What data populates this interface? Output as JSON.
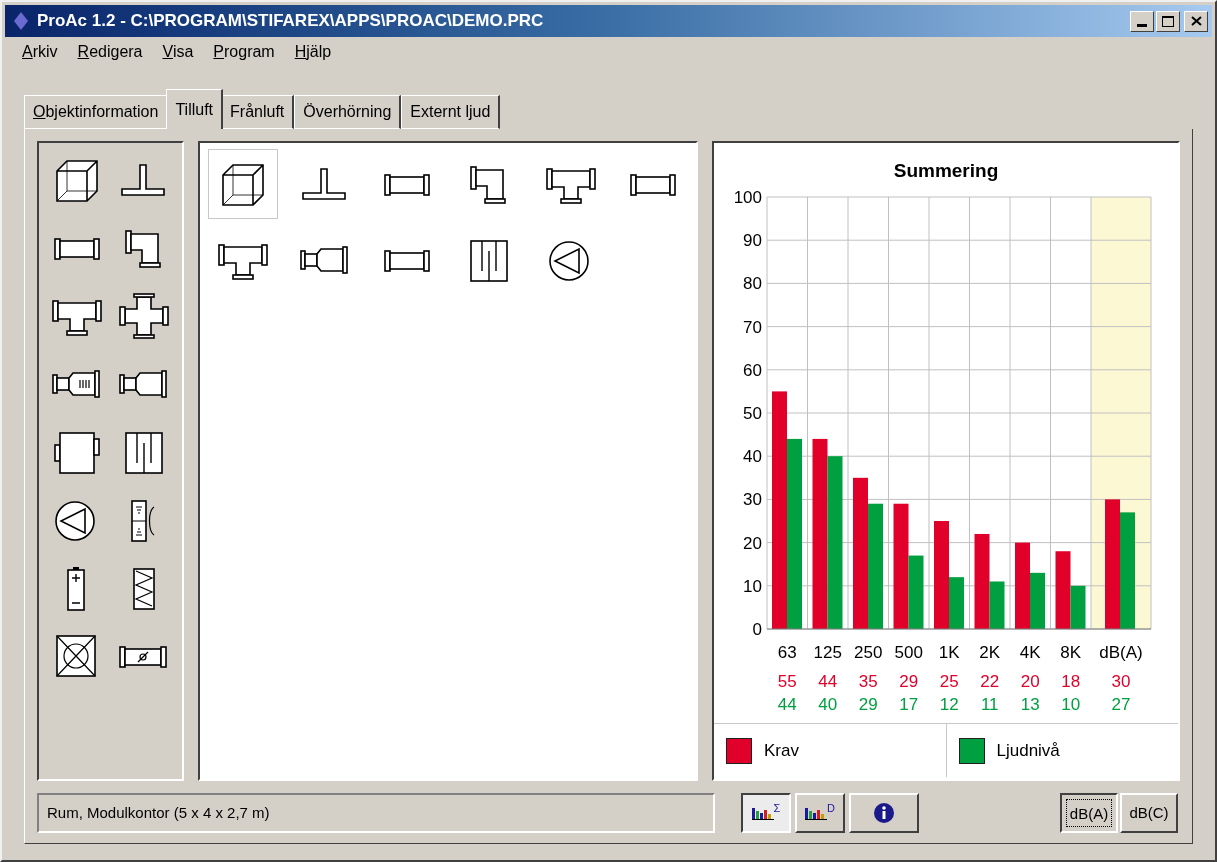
{
  "window": {
    "title": "ProAc 1.2 - C:\\PROGRAM\\STIFAREX\\APPS\\PROAC\\DEMO.PRC"
  },
  "menu": [
    {
      "label": "Arkiv",
      "mnemonic": true
    },
    {
      "label": "Redigera",
      "mnemonic": true
    },
    {
      "label": "Visa",
      "mnemonic": true
    },
    {
      "label": "Program",
      "mnemonic": true
    },
    {
      "label": "Hjälp",
      "mnemonic": true
    }
  ],
  "tabs": [
    {
      "label": "Objektinformation",
      "selected": false,
      "mnemonic": true
    },
    {
      "label": "Tilluft",
      "selected": true,
      "mnemonic": false
    },
    {
      "label": "Frånluft",
      "selected": false,
      "mnemonic": false
    },
    {
      "label": "Överhörning",
      "selected": false,
      "mnemonic": false
    },
    {
      "label": "Externt ljud",
      "selected": false,
      "mnemonic": false
    }
  ],
  "palette": [
    {
      "kind": "cube"
    },
    {
      "kind": "stub"
    },
    {
      "kind": "duct"
    },
    {
      "kind": "elbow"
    },
    {
      "kind": "tee"
    },
    {
      "kind": "cross"
    },
    {
      "kind": "silencer"
    },
    {
      "kind": "reducer"
    },
    {
      "kind": "plenum"
    },
    {
      "kind": "baffle"
    },
    {
      "kind": "fan"
    },
    {
      "kind": "terminal"
    },
    {
      "kind": "battery"
    },
    {
      "kind": "coil"
    },
    {
      "kind": "crossbox"
    },
    {
      "kind": "damper"
    }
  ],
  "chain": [
    {
      "kind": "cube",
      "selected": true
    },
    {
      "kind": "stub",
      "selected": false
    },
    {
      "kind": "duct",
      "selected": false
    },
    {
      "kind": "elbow",
      "selected": false
    },
    {
      "kind": "tee",
      "selected": false
    },
    {
      "kind": "duct",
      "selected": false
    },
    {
      "kind": "tee",
      "selected": false
    },
    {
      "kind": "reducer",
      "selected": false
    },
    {
      "kind": "duct",
      "selected": false
    },
    {
      "kind": "baffle",
      "selected": false
    },
    {
      "kind": "fan",
      "selected": false
    }
  ],
  "chart": {
    "chart_data": {
      "type": "bar",
      "title": "Summering",
      "categories": [
        "63",
        "125",
        "250",
        "500",
        "1K",
        "2K",
        "4K",
        "8K",
        "dB(A)"
      ],
      "series": [
        {
          "name": "Krav",
          "color": "#e0002a",
          "values": [
            55,
            44,
            35,
            29,
            25,
            22,
            20,
            18,
            30
          ]
        },
        {
          "name": "Ljudnivå",
          "color": "#00a040",
          "values": [
            44,
            40,
            29,
            17,
            12,
            11,
            13,
            10,
            27
          ]
        }
      ],
      "ylim": [
        0,
        100
      ],
      "yticks": [
        0,
        10,
        20,
        30,
        40,
        50,
        60,
        70,
        80,
        90,
        100
      ],
      "data_labels": true,
      "grid": true,
      "legend": true
    }
  },
  "status": "Rum, Modulkontor (5 x 4 x 2,7 m)",
  "view_buttons": [
    {
      "kind": "sum",
      "mark": "Σ",
      "selected": true
    },
    {
      "kind": "diff",
      "mark": "D",
      "selected": false
    },
    {
      "kind": "info",
      "selected": false
    }
  ],
  "unit_buttons": [
    {
      "label": "dB(A)",
      "selected": true
    },
    {
      "label": "dB(C)",
      "selected": false
    }
  ]
}
